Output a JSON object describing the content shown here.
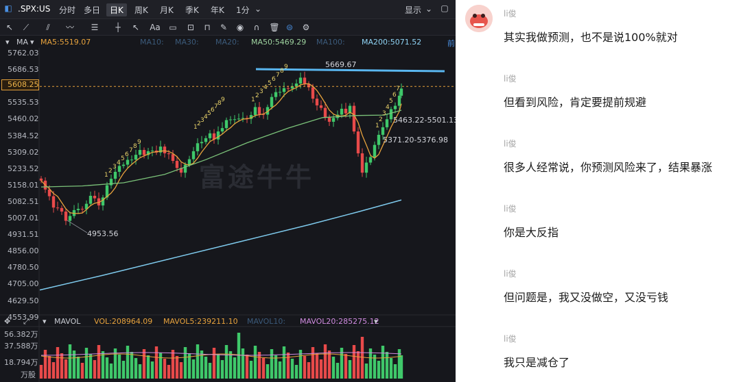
{
  "toolbar": {
    "symbol": ".SPX:US",
    "tabs": [
      "分时",
      "多日",
      "日K",
      "周K",
      "月K",
      "季K",
      "年K",
      "1分"
    ],
    "active_tab": "日K",
    "display_label": "显示",
    "font_btn": "Aa"
  },
  "ma_bar": {
    "type_label": "MA",
    "items": [
      {
        "text": "MA5:5519.07",
        "color": "#e8a33d"
      },
      {
        "text": "MA10:",
        "color": "#3b5a7a"
      },
      {
        "text": "MA30:",
        "color": "#3b5a7a"
      },
      {
        "text": "MA20:",
        "color": "#3b5a7a"
      },
      {
        "text": "MA50:5469.29",
        "color": "#9fd4a0"
      },
      {
        "text": "MA100:",
        "color": "#3b5a7a"
      },
      {
        "text": "MA200:5071.52",
        "color": "#8fd3f4"
      },
      {
        "text": "前",
        "color": "#4a90e2"
      }
    ]
  },
  "price_axis": {
    "ticks": [
      "5762.03",
      "5686.53",
      "5608.25",
      "5535.53",
      "5460.02",
      "5384.52",
      "5309.02",
      "5233.52",
      "5158.01",
      "5082.51",
      "5007.01",
      "4931.51",
      "4856.00",
      "4780.50",
      "4705.00",
      "4629.50",
      "4553.99"
    ],
    "current_price": "5608.25"
  },
  "annotations": {
    "high": "5669.67",
    "low": "4953.56",
    "range1": "5463.22-5501.13",
    "range2": "5371.20-5376.98"
  },
  "watermark": "富途牛牛",
  "volume_bar": {
    "label": "MAVOL",
    "items": [
      {
        "text": "VOL:208964.09",
        "color": "#e8a33d"
      },
      {
        "text": "MAVOL5:239211.10",
        "color": "#e8a33d"
      },
      {
        "text": "MAVOL10:",
        "color": "#3b5a7a"
      },
      {
        "text": "MAVOL20:285275.12",
        "color": "#d08be0"
      }
    ],
    "ticks": [
      "56.382万",
      "37.588万",
      "18.794万",
      "万股"
    ]
  },
  "chat": {
    "messages": [
      {
        "user": "li俊",
        "text": "其实我做预测，也不是说100%就对"
      },
      {
        "user": "li俊",
        "text": "但看到风险，肯定要提前规避"
      },
      {
        "user": "li俊",
        "text": "很多人经常说，你预测风险来了，结果暴涨"
      },
      {
        "user": "li俊",
        "text": "你是大反指"
      },
      {
        "user": "li俊",
        "text": "但问题是，我又没做空，又没亏钱"
      },
      {
        "user": "li俊",
        "text": "我只是减仓了"
      }
    ]
  },
  "colors": {
    "up": "#e84a4a",
    "down": "#3fc86a",
    "ma5": "#e8a33d",
    "ma50": "#7cc47a",
    "ma200": "#7fcbee",
    "resistance": "#5ab7f0"
  },
  "candle_sequence_labels": [
    "1",
    "2",
    "3",
    "4",
    "5",
    "6",
    "7",
    "8",
    "9"
  ]
}
